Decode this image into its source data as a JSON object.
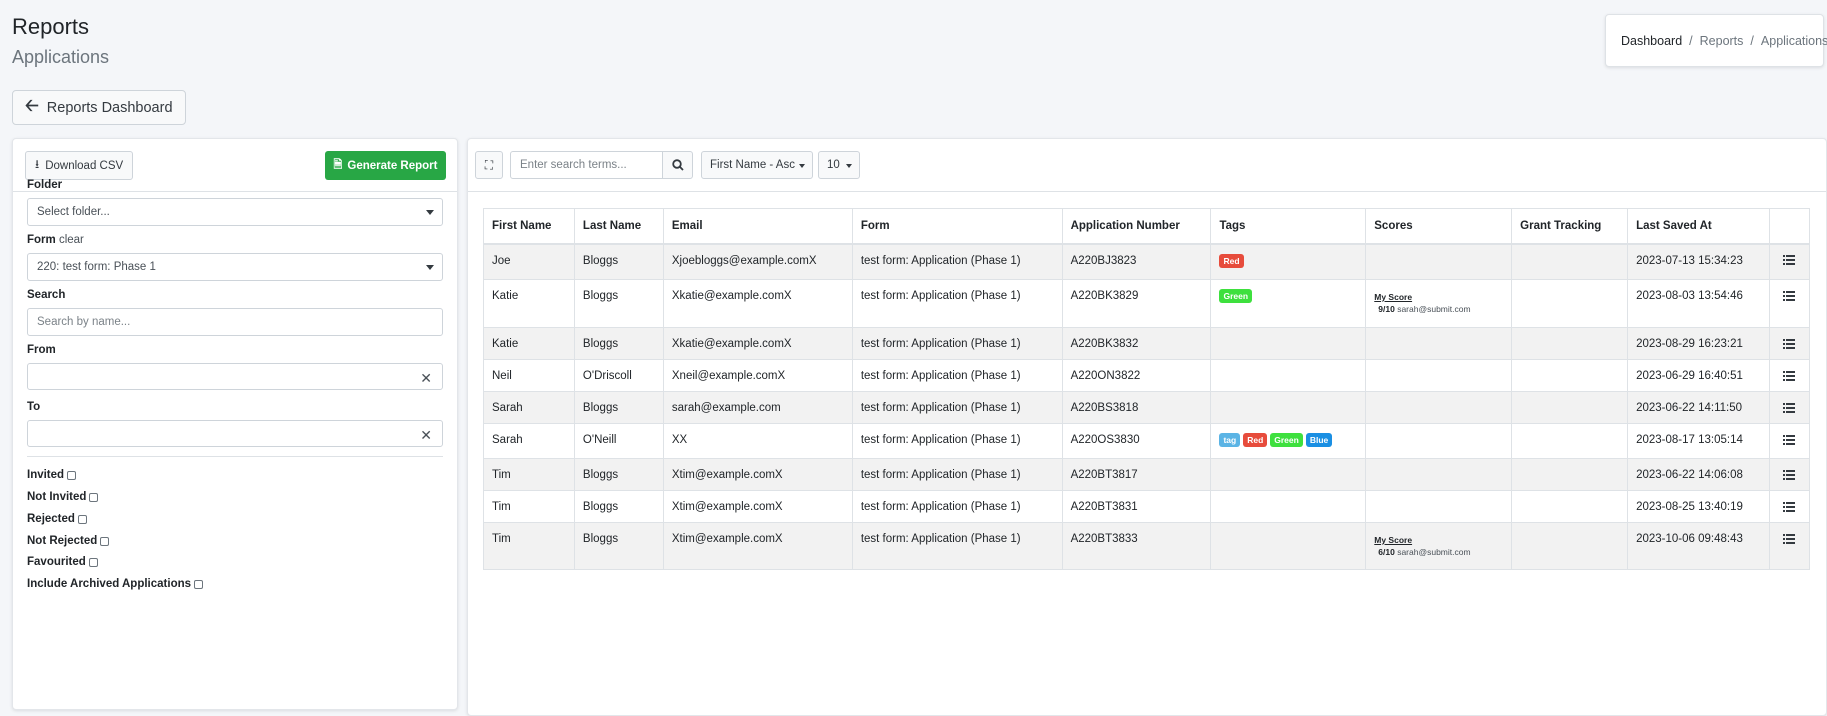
{
  "header": {
    "title": "Reports",
    "subtitle": "Applications"
  },
  "breadcrumb": {
    "items": [
      "Dashboard",
      "Reports",
      "Applications"
    ],
    "separator": "/"
  },
  "back_button": {
    "label": "Reports Dashboard",
    "icon": "arrow-left-icon"
  },
  "filters": {
    "download_label": "Download CSV",
    "generate_label": "Generate Report",
    "folder_label": "Folder",
    "folder_value": "Select folder...",
    "form_label": "Form",
    "form_clear": "clear",
    "form_value": "220: test form: Phase 1",
    "search_label": "Search",
    "search_placeholder": "Search by name...",
    "from_label": "From",
    "to_label": "To",
    "checkboxes": [
      "Invited",
      "Not Invited",
      "Rejected",
      "Not Rejected",
      "Favourited",
      "Include Archived Applications"
    ]
  },
  "toolbar": {
    "search_placeholder": "Enter search terms...",
    "sort_value": "First Name - Asc",
    "page_size": "10"
  },
  "colors": {
    "green_button": "#28a745",
    "tag_red": "#e74c3c",
    "tag_green": "#3ee03e",
    "tag_blue": "#1a8fe3",
    "tag_default": "#5bb4e5"
  },
  "table": {
    "headers": [
      "First Name",
      "Last Name",
      "Email",
      "Form",
      "Application Number",
      "Tags",
      "Scores",
      "Grant Tracking",
      "Last Saved At",
      ""
    ],
    "rows": [
      {
        "first": "Joe",
        "last": "Bloggs",
        "email": "Xjoebloggs@example.comX",
        "form": "test form: Application (Phase 1)",
        "number": "A220BJ3823",
        "tags": [
          "Red"
        ],
        "score": null,
        "saved": "2023-07-13 15:34:23"
      },
      {
        "first": "Katie",
        "last": "Bloggs",
        "email": "Xkatie@example.comX",
        "form": "test form: Application (Phase 1)",
        "number": "A220BK3829",
        "tags": [
          "Green"
        ],
        "score": {
          "title": "My Score",
          "value": "9",
          "max": "/10",
          "by": "sarah@submit.com"
        },
        "saved": "2023-08-03 13:54:46"
      },
      {
        "first": "Katie",
        "last": "Bloggs",
        "email": "Xkatie@example.comX",
        "form": "test form: Application (Phase 1)",
        "number": "A220BK3832",
        "tags": [],
        "score": null,
        "saved": "2023-08-29 16:23:21"
      },
      {
        "first": "Neil",
        "last": "O'Driscoll",
        "email": "Xneil@example.comX",
        "form": "test form: Application (Phase 1)",
        "number": "A220ON3822",
        "tags": [],
        "score": null,
        "saved": "2023-06-29 16:40:51"
      },
      {
        "first": "Sarah",
        "last": "Bloggs",
        "email": "sarah@example.com",
        "form": "test form: Application (Phase 1)",
        "number": "A220BS3818",
        "tags": [],
        "score": null,
        "saved": "2023-06-22 14:11:50"
      },
      {
        "first": "Sarah",
        "last": "O'Neill",
        "email": "XX",
        "form": "test form: Application (Phase 1)",
        "number": "A220OS3830",
        "tags": [
          "tag",
          "Red",
          "Green",
          "Blue"
        ],
        "score": null,
        "saved": "2023-08-17 13:05:14"
      },
      {
        "first": "Tim",
        "last": "Bloggs",
        "email": "Xtim@example.comX",
        "form": "test form: Application (Phase 1)",
        "number": "A220BT3817",
        "tags": [],
        "score": null,
        "saved": "2023-06-22 14:06:08"
      },
      {
        "first": "Tim",
        "last": "Bloggs",
        "email": "Xtim@example.comX",
        "form": "test form: Application (Phase 1)",
        "number": "A220BT3831",
        "tags": [],
        "score": null,
        "saved": "2023-08-25 13:40:19"
      },
      {
        "first": "Tim",
        "last": "Bloggs",
        "email": "Xtim@example.comX",
        "form": "test form: Application (Phase 1)",
        "number": "A220BT3833",
        "tags": [],
        "score": {
          "title": "My Score",
          "value": "6",
          "max": "/10",
          "by": "sarah@submit.com"
        },
        "saved": "2023-10-06 09:48:43"
      }
    ]
  }
}
